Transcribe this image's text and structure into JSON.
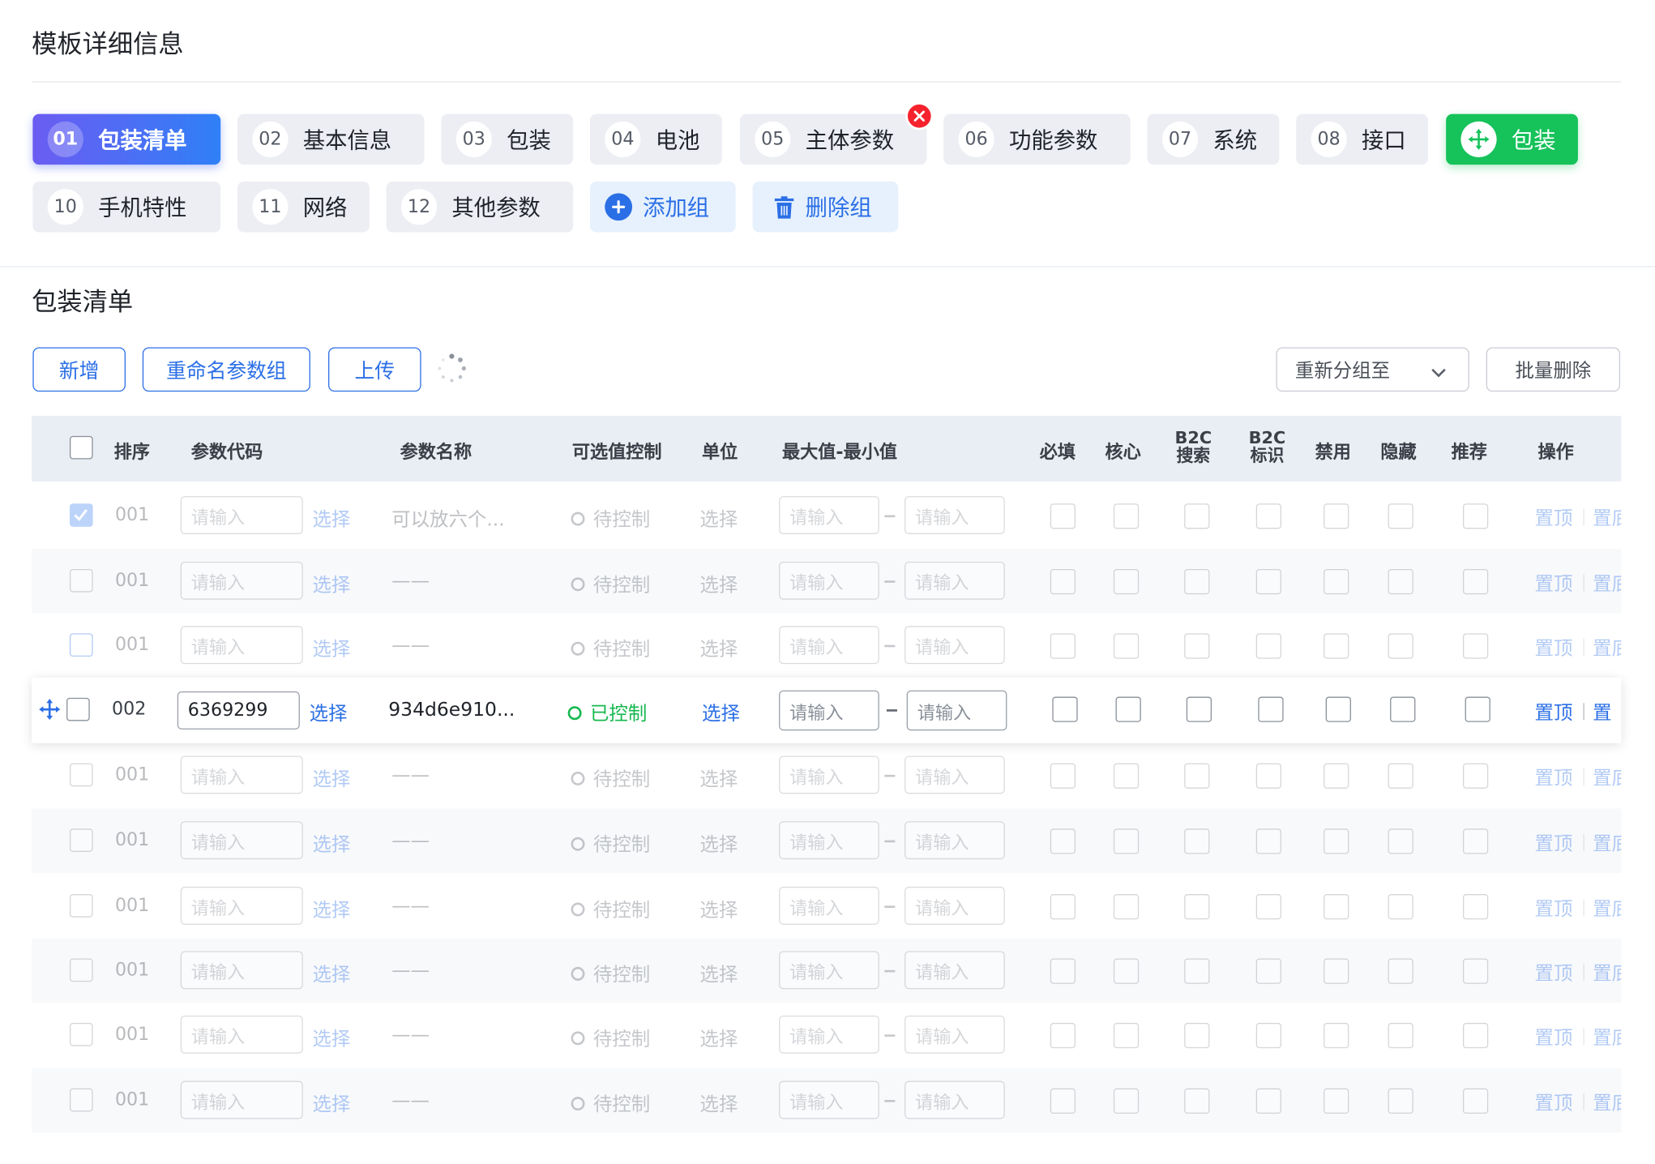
{
  "page_title": "模板详细信息",
  "tabs": [
    {
      "num": "01",
      "label": "包装清单",
      "state": "active"
    },
    {
      "num": "02",
      "label": "基本信息"
    },
    {
      "num": "03",
      "label": "包装"
    },
    {
      "num": "04",
      "label": "电池"
    },
    {
      "num": "05",
      "label": "主体参数"
    },
    {
      "num": "06",
      "label": "功能参数"
    },
    {
      "num": "07",
      "label": "系统"
    },
    {
      "num": "08",
      "label": "接口"
    },
    {
      "num": "",
      "label": "包装",
      "state": "dragging"
    },
    {
      "num": "10",
      "label": "手机特性"
    },
    {
      "num": "11",
      "label": "网络"
    },
    {
      "num": "12",
      "label": "其他参数"
    }
  ],
  "group_actions": {
    "add": "添加组",
    "delete": "删除组"
  },
  "section_title": "包装清单",
  "toolbar": {
    "add": "新增",
    "rename": "重命名参数组",
    "upload": "上传",
    "regroup_select": "重新分组至",
    "batch_delete": "批量删除"
  },
  "columns": {
    "order": "排序",
    "code": "参数代码",
    "name": "参数名称",
    "control": "可选值控制",
    "unit": "单位",
    "range": "最大值-最小值",
    "required": "必填",
    "core": "核心",
    "b2c_search": [
      "B2C",
      "搜索"
    ],
    "b2c_mark": [
      "B2C",
      "标识"
    ],
    "disabled": "禁用",
    "hidden": "隐藏",
    "recommend": "推荐",
    "actions": "操作"
  },
  "rows": [
    {
      "order": "001",
      "code_placeholder": "请输入",
      "code_link": "选择",
      "name": "可以放六个...",
      "status": "待控制",
      "unit": "选择",
      "min_placeholder": "请输入",
      "max_placeholder": "请输入",
      "act1": "置顶",
      "act2": "置底",
      "checked": true
    },
    {
      "order": "001",
      "code_placeholder": "请输入",
      "code_link": "选择",
      "name": "——",
      "status": "待控制",
      "unit": "选择",
      "min_placeholder": "请输入",
      "max_placeholder": "请输入",
      "act1": "置顶",
      "act2": "置底"
    },
    {
      "order": "001",
      "code_placeholder": "请输入",
      "code_link": "选择",
      "name": "——",
      "status": "待控制",
      "unit": "选择",
      "min_placeholder": "请输入",
      "max_placeholder": "请输入",
      "act1": "置顶",
      "act2": "置底"
    },
    {
      "order": "002",
      "code_value": "6369299",
      "code_link": "选择",
      "name": "934d6e910...",
      "status": "已控制",
      "unit": "选择",
      "min_placeholder": "请输入",
      "max_placeholder": "请输入",
      "act1": "置顶",
      "act2": "置",
      "focused": true
    },
    {
      "order": "001",
      "code_placeholder": "请输入",
      "code_link": "选择",
      "name": "——",
      "status": "待控制",
      "unit": "选择",
      "min_placeholder": "请输入",
      "max_placeholder": "请输入",
      "act1": "置顶",
      "act2": "置底"
    },
    {
      "order": "001",
      "code_placeholder": "请输入",
      "code_link": "选择",
      "name": "——",
      "status": "待控制",
      "unit": "选择",
      "min_placeholder": "请输入",
      "max_placeholder": "请输入",
      "act1": "置顶",
      "act2": "置底"
    },
    {
      "order": "001",
      "code_placeholder": "请输入",
      "code_link": "选择",
      "name": "——",
      "status": "待控制",
      "unit": "选择",
      "min_placeholder": "请输入",
      "max_placeholder": "请输入",
      "act1": "置顶",
      "act2": "置底"
    },
    {
      "order": "001",
      "code_placeholder": "请输入",
      "code_link": "选择",
      "name": "——",
      "status": "待控制",
      "unit": "选择",
      "min_placeholder": "请输入",
      "max_placeholder": "请输入",
      "act1": "置顶",
      "act2": "置底"
    },
    {
      "order": "001",
      "code_placeholder": "请输入",
      "code_link": "选择",
      "name": "——",
      "status": "待控制",
      "unit": "选择",
      "min_placeholder": "请输入",
      "max_placeholder": "请输入",
      "act1": "置顶",
      "act2": "置底"
    },
    {
      "order": "001",
      "code_placeholder": "请输入",
      "code_link": "选择",
      "name": "——",
      "status": "待控制",
      "unit": "选择",
      "min_placeholder": "请输入",
      "max_placeholder": "请输入",
      "act1": "置顶",
      "act2": "置底"
    }
  ],
  "colors": {
    "primary": "#2b6fe6",
    "success": "#16c25a",
    "danger": "#f5222d",
    "header_bg": "#e9edf4"
  },
  "icons": {
    "close": "close-icon",
    "move": "move-icon",
    "plus": "plus-icon",
    "trash": "trash-icon",
    "chevron": "chevron-down-icon",
    "spinner": "loading-spinner-icon"
  }
}
